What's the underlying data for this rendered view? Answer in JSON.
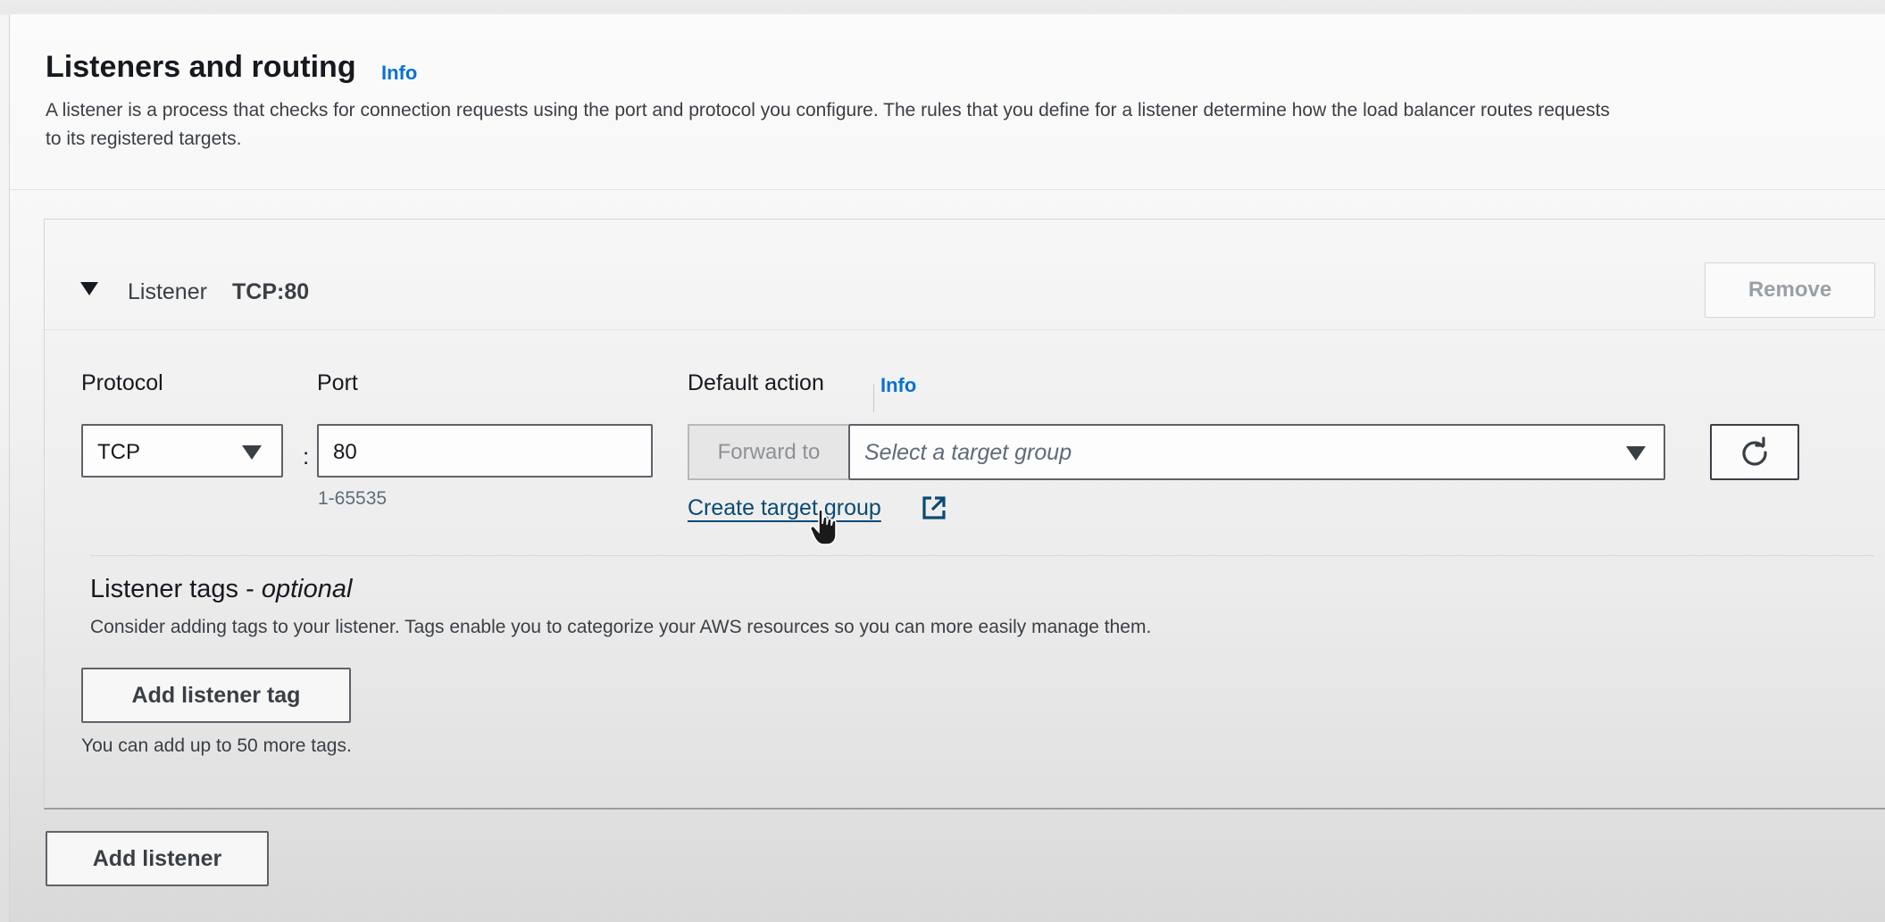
{
  "section": {
    "title": "Listeners and routing",
    "info_label": "Info",
    "description_line1": "A listener is a process that checks for connection requests using the port and protocol you configure. The rules that you define for a listener determine how the load balancer routes requests",
    "description_line2": "to its registered targets."
  },
  "listener": {
    "label": "Listener",
    "name": "TCP:80",
    "remove_label": "Remove",
    "protocol_label": "Protocol",
    "protocol_value": "TCP",
    "port_label": "Port",
    "port_value": "80",
    "port_hint": "1-65535",
    "default_action_label": "Default action",
    "default_action_info": "Info",
    "forward_to_label": "Forward to",
    "target_group_placeholder": "Select a target group",
    "create_target_group_label": "Create target group"
  },
  "tags": {
    "title": "Listener tags - ",
    "title_optional": "optional",
    "description": "Consider adding tags to your listener. Tags enable you to categorize your AWS resources so you can more easily manage them.",
    "add_tag_label": "Add listener tag",
    "limit_text": "You can add up to 50 more tags."
  },
  "footer": {
    "add_listener_label": "Add listener"
  },
  "icons": [
    "caret-down-icon",
    "dropdown-arrow-icon",
    "refresh-icon",
    "external-link-icon",
    "hand-cursor-icon"
  ],
  "colors": {
    "link": "#0972d3",
    "text": "#16191f",
    "border": "#5e6269"
  }
}
